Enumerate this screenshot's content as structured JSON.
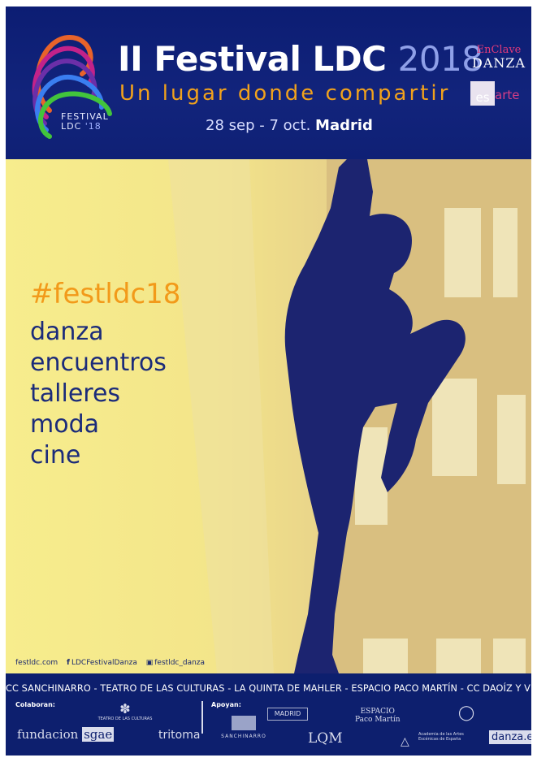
{
  "header": {
    "logo_text_line1": "FESTIVAL",
    "logo_text_line2": "LDC",
    "logo_text_year": "'18",
    "title": "II Festival LDC",
    "title_year": "2018",
    "subtitle": "Un lugar donde compartir",
    "dates": "28 sep - 7 oct.",
    "city": "Madrid",
    "partner_enclave": "EnClave",
    "partner_danza": "DANZA",
    "partner_es": "es",
    "partner_arte": "arte"
  },
  "main": {
    "hashtag": "#festldc18",
    "activities": [
      "danza",
      "encuentros",
      "talleres",
      "moda",
      "cine"
    ]
  },
  "social": {
    "website": "festldc.com",
    "facebook": "LDCFestivalDanza",
    "instagram": "festldc_danza"
  },
  "venues": "CC SANCHINARRO - TEATRO DE LAS CULTURAS - LA QUINTA DE MAHLER - ESPACIO PACO MARTÍN - CC DAOÍZ Y VELARDE",
  "footer": {
    "colaboran_label": "Colaboran:",
    "apoyan_label": "Apoyan:",
    "sponsors": {
      "fundacion": "fundacion",
      "sgae": "sgae",
      "teatro_culturas": "TEATRO DE LAS CULTURAS",
      "tritoma": "tritoma",
      "sanchinarro": "SANCHINARRO",
      "madrid": "MADRID",
      "lqm": "LQM",
      "espacio": "ESPACIO",
      "paco_martin": "Paco Martín",
      "academia": "Academia de las Artes Escénicas de España",
      "danza_es": "danza.es"
    }
  },
  "colors": {
    "navy": "#0d1f6e",
    "orange": "#f29a1a",
    "yellow": "#f5e88a",
    "pink": "#e23a7a"
  }
}
